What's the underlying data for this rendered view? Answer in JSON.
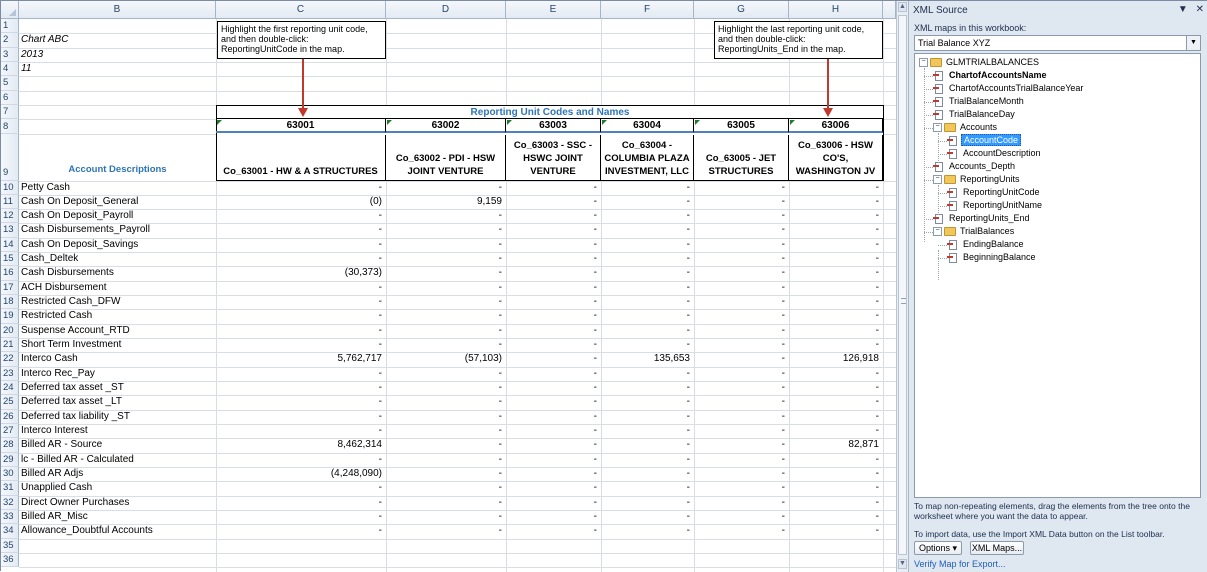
{
  "columns": [
    "B",
    "C",
    "D",
    "E",
    "F",
    "G",
    "H"
  ],
  "rows": [
    "1",
    "2",
    "3",
    "4",
    "5",
    "6",
    "7",
    "8",
    "9",
    "10",
    "11",
    "12",
    "13",
    "14",
    "15",
    "16",
    "17",
    "18",
    "19",
    "20",
    "21",
    "22",
    "23",
    "24",
    "25",
    "26",
    "27",
    "28",
    "29",
    "30",
    "31",
    "32",
    "33",
    "34",
    "35",
    "36"
  ],
  "header_cells": {
    "chart": "Chart ABC",
    "year": "2013",
    "month": "11",
    "title": "Reporting Unit Codes and Names",
    "desc_header": "Account Descriptions"
  },
  "callouts": {
    "first": "Highlight the first reporting unit code, and then double-click: ReportingUnitCode in the map.",
    "last": "Highlight the last reporting unit code, and then double-click: ReportingUnits_End in the map."
  },
  "units": [
    {
      "code": "63001",
      "name": "Co_63001 - HW & A STRUCTURES"
    },
    {
      "code": "63002",
      "name": "Co_63002 - PDI - HSW JOINT VENTURE"
    },
    {
      "code": "63003",
      "name": "Co_63003 - SSC - HSWC JOINT VENTURE"
    },
    {
      "code": "63004",
      "name": "Co_63004 - COLUMBIA PLAZA INVESTMENT, LLC"
    },
    {
      "code": "63005",
      "name": "Co_63005 - JET STRUCTURES"
    },
    {
      "code": "63006",
      "name": "Co_63006 - HSW CO'S, WASHINGTON JV"
    }
  ],
  "accounts": [
    {
      "desc": "Petty Cash",
      "vals": [
        "-",
        "-",
        "-",
        "-",
        "-",
        "-"
      ]
    },
    {
      "desc": "Cash On Deposit_General",
      "vals": [
        "(0)",
        "9,159",
        "-",
        "-",
        "-",
        "-"
      ]
    },
    {
      "desc": "Cash On Deposit_Payroll",
      "vals": [
        "-",
        "-",
        "-",
        "-",
        "-",
        "-"
      ]
    },
    {
      "desc": "Cash Disbursements_Payroll",
      "vals": [
        "-",
        "-",
        "-",
        "-",
        "-",
        "-"
      ]
    },
    {
      "desc": "Cash On Deposit_Savings",
      "vals": [
        "-",
        "-",
        "-",
        "-",
        "-",
        "-"
      ]
    },
    {
      "desc": "Cash_Deltek",
      "vals": [
        "-",
        "-",
        "-",
        "-",
        "-",
        "-"
      ]
    },
    {
      "desc": "Cash Disbursements",
      "vals": [
        "(30,373)",
        "-",
        "-",
        "-",
        "-",
        "-"
      ]
    },
    {
      "desc": "ACH Disbursement",
      "vals": [
        "-",
        "-",
        "-",
        "-",
        "-",
        "-"
      ]
    },
    {
      "desc": "Restricted Cash_DFW",
      "vals": [
        "-",
        "-",
        "-",
        "-",
        "-",
        "-"
      ]
    },
    {
      "desc": "Restricted Cash",
      "vals": [
        "-",
        "-",
        "-",
        "-",
        "-",
        "-"
      ]
    },
    {
      "desc": "Suspense Account_RTD",
      "vals": [
        "-",
        "-",
        "-",
        "-",
        "-",
        "-"
      ]
    },
    {
      "desc": "Short Term Investment",
      "vals": [
        "-",
        "-",
        "-",
        "-",
        "-",
        "-"
      ]
    },
    {
      "desc": "Interco Cash",
      "vals": [
        "5,762,717",
        "(57,103)",
        "-",
        "135,653",
        "-",
        "126,918"
      ]
    },
    {
      "desc": "Interco Rec_Pay",
      "vals": [
        "-",
        "-",
        "-",
        "-",
        "-",
        "-"
      ]
    },
    {
      "desc": "Deferred tax asset _ST",
      "vals": [
        "-",
        "-",
        "-",
        "-",
        "-",
        "-"
      ]
    },
    {
      "desc": "Deferred tax asset _LT",
      "vals": [
        "-",
        "-",
        "-",
        "-",
        "-",
        "-"
      ]
    },
    {
      "desc": "Deferred tax liability _ST",
      "vals": [
        "-",
        "-",
        "-",
        "-",
        "-",
        "-"
      ]
    },
    {
      "desc": "Interco Interest",
      "vals": [
        "-",
        "-",
        "-",
        "-",
        "-",
        "-"
      ]
    },
    {
      "desc": "Billed AR - Source",
      "vals": [
        "8,462,314",
        "-",
        "-",
        "-",
        "-",
        "82,871"
      ]
    },
    {
      "desc": "lc - Billed AR - Calculated",
      "vals": [
        "-",
        "-",
        "-",
        "-",
        "-",
        "-"
      ]
    },
    {
      "desc": "Billed AR Adjs",
      "vals": [
        "(4,248,090)",
        "-",
        "-",
        "-",
        "-",
        "-"
      ]
    },
    {
      "desc": "Unapplied Cash",
      "vals": [
        "-",
        "-",
        "-",
        "-",
        "-",
        "-"
      ]
    },
    {
      "desc": "Direct Owner Purchases",
      "vals": [
        "-",
        "-",
        "-",
        "-",
        "-",
        "-"
      ]
    },
    {
      "desc": "Billed AR_Misc",
      "vals": [
        "-",
        "-",
        "-",
        "-",
        "-",
        "-"
      ]
    },
    {
      "desc": "Allowance_Doubtful Accounts",
      "vals": [
        "-",
        "-",
        "-",
        "-",
        "-",
        "-"
      ]
    }
  ],
  "pane": {
    "title": "XML Source",
    "dropdown_glyph": "▼",
    "close_glyph": "✕",
    "maps_label": "XML maps in this workbook:",
    "selected_map": "Trial Balance XYZ",
    "tree": [
      {
        "label": "GLMTRIALBALANCES",
        "type": "folder",
        "depth": 0,
        "toggle": "−"
      },
      {
        "label": "ChartofAccountsName",
        "type": "el",
        "depth": 1,
        "bold": true
      },
      {
        "label": "ChartofAccountsTrialBalanceYear",
        "type": "el",
        "depth": 1
      },
      {
        "label": "TrialBalanceMonth",
        "type": "el",
        "depth": 1
      },
      {
        "label": "TrialBalanceDay",
        "type": "el",
        "depth": 1
      },
      {
        "label": "Accounts",
        "type": "folder",
        "depth": 1,
        "toggle": "−"
      },
      {
        "label": "AccountCode",
        "type": "el",
        "depth": 2,
        "selected": true
      },
      {
        "label": "AccountDescription",
        "type": "el",
        "depth": 2
      },
      {
        "label": "Accounts_Depth",
        "type": "el",
        "depth": 1
      },
      {
        "label": "ReportingUnits",
        "type": "folder",
        "depth": 1,
        "toggle": "−"
      },
      {
        "label": "ReportingUnitCode",
        "type": "el",
        "depth": 2
      },
      {
        "label": "ReportingUnitName",
        "type": "el",
        "depth": 2
      },
      {
        "label": "ReportingUnits_End",
        "type": "el",
        "depth": 1
      },
      {
        "label": "TrialBalances",
        "type": "folder",
        "depth": 1,
        "toggle": "−"
      },
      {
        "label": "EndingBalance",
        "type": "el",
        "depth": 2
      },
      {
        "label": "BeginningBalance",
        "type": "el",
        "depth": 2
      }
    ],
    "help1": "To map non-repeating elements, drag the elements from the tree onto the worksheet where you want the data to appear.",
    "help2": "To import data, use the Import XML Data button on the List toolbar.",
    "options_button": "Options ▾",
    "xmlmaps_button": "XML Maps...",
    "verify_link": "Verify Map for Export..."
  },
  "colors": {
    "accent": "#4f81bd",
    "title": "#2e75b6",
    "arrow": "#c0392b",
    "selection": "#3399ff"
  }
}
